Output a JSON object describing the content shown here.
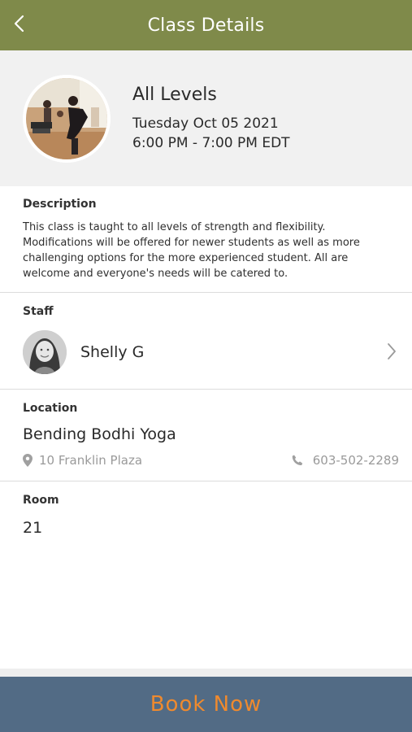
{
  "header": {
    "title": "Class Details",
    "back_icon": "chevron-left-icon"
  },
  "class_info": {
    "level": "All Levels",
    "date": "Tuesday Oct 05 2021",
    "time": "6:00 PM - 7:00 PM EDT"
  },
  "description": {
    "label": "Description",
    "text": "This class is taught to all levels of strength and flexibility. Modifications will be offered for newer students as well as more challenging options for the more experienced student. All are welcome and everyone's needs will be catered to."
  },
  "staff": {
    "label": "Staff",
    "name": "Shelly G"
  },
  "location": {
    "label": "Location",
    "name": "Bending Bodhi Yoga",
    "address": "10 Franklin Plaza",
    "phone": "603-502-2289"
  },
  "room": {
    "label": "Room",
    "value": "21"
  },
  "book": {
    "label": "Book Now"
  },
  "colors": {
    "header_bg": "#7f8a4a",
    "summary_bg": "#f1f1f1",
    "book_bg": "#526b85",
    "book_text": "#ef8a2e"
  }
}
